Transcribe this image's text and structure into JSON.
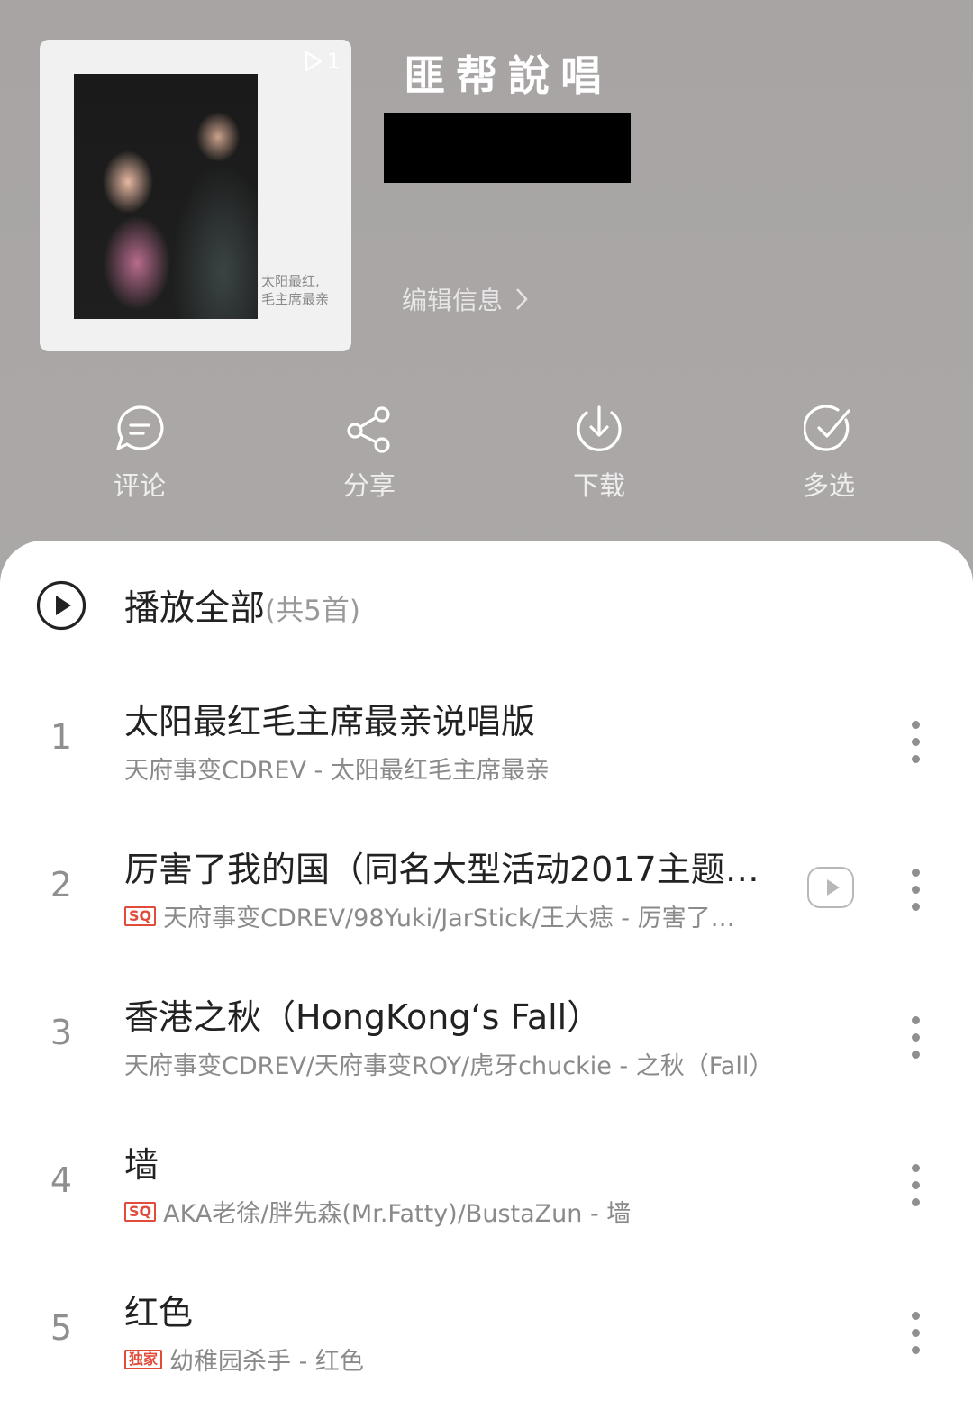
{
  "header": {
    "cover_caption_line1": "太阳最红,",
    "cover_caption_line2": "毛主席最亲",
    "cover_play_count": "1",
    "title": "匪帮說唱",
    "edit_info_label": "编辑信息"
  },
  "actions": [
    {
      "label": "评论",
      "icon": "comment-icon"
    },
    {
      "label": "分享",
      "icon": "share-icon"
    },
    {
      "label": "下载",
      "icon": "download-icon"
    },
    {
      "label": "多选",
      "icon": "multiselect-icon"
    }
  ],
  "play_all": {
    "label": "播放全部",
    "count": "(共5首)"
  },
  "songs": [
    {
      "index": "1",
      "title": "太阳最红毛主席最亲说唱版",
      "badge": "",
      "subtitle": "天府事变CDREV - 太阳最红毛主席最亲",
      "has_mv": false
    },
    {
      "index": "2",
      "title": "厉害了我的国（同名大型活动2017主题…",
      "badge": "SQ",
      "subtitle": "天府事变CDREV/98Yuki/JarStick/王大痣 - 厉害了…",
      "has_mv": true
    },
    {
      "index": "3",
      "title": "香港之秋（HongKong‘s Fall）",
      "badge": "",
      "subtitle": "天府事变CDREV/天府事变ROY/虎牙chuckie - 之秋（Fall）",
      "has_mv": false
    },
    {
      "index": "4",
      "title": "墙",
      "badge": "SQ",
      "subtitle": "AKA老徐/胖先森(Mr.Fatty)/BustaZun - 墙",
      "has_mv": false
    },
    {
      "index": "5",
      "title": "红色",
      "badge": "独家",
      "subtitle": "幼稚园杀手 - 红色",
      "has_mv": false
    }
  ],
  "colors": {
    "header_bg": "#a9a6a5",
    "badge_red": "#e24a3a",
    "text_primary": "#222222",
    "text_secondary": "#8a8a8a"
  }
}
